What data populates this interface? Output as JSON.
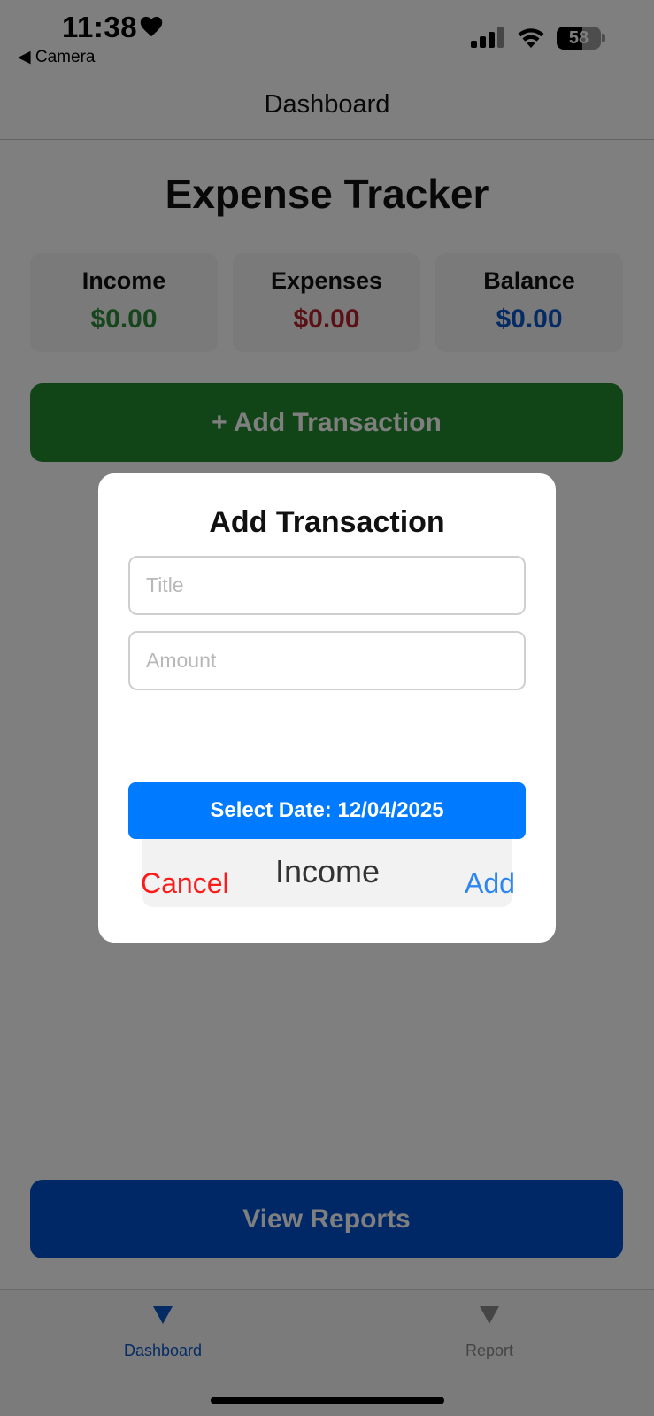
{
  "status_bar": {
    "time": "11:38",
    "back_label": "◀ Camera",
    "battery_percent": "58",
    "battery_level": 0.58
  },
  "header": {
    "title": "Dashboard"
  },
  "main": {
    "title": "Expense Tracker",
    "summary": [
      {
        "label": "Income",
        "value": "$0.00",
        "color": "#2e8b3a"
      },
      {
        "label": "Expenses",
        "value": "$0.00",
        "color": "#b5212b"
      },
      {
        "label": "Balance",
        "value": "$0.00",
        "color": "#0a57c8"
      }
    ],
    "add_button": "+ Add Transaction",
    "reports_button": "View Reports"
  },
  "modal": {
    "title": "Add Transaction",
    "title_placeholder": "Title",
    "amount_placeholder": "Amount",
    "date_button": "Select Date: 12/04/2025",
    "type_value": "Income",
    "cancel_label": "Cancel",
    "add_label": "Add"
  },
  "tab_bar": {
    "tabs": [
      {
        "label": "Dashboard",
        "icon": "triangle-down-icon",
        "active": true
      },
      {
        "label": "Report",
        "icon": "triangle-down-icon",
        "active": false
      }
    ]
  },
  "colors": {
    "active_tab": "#0a57c8",
    "inactive_tab": "#8a8a8a",
    "add_button_bg": "#228b2f",
    "reports_button_bg": "#0051cf",
    "date_button_bg": "#007aff",
    "cancel": "#ff1a1a",
    "confirm": "#2e86f0"
  }
}
